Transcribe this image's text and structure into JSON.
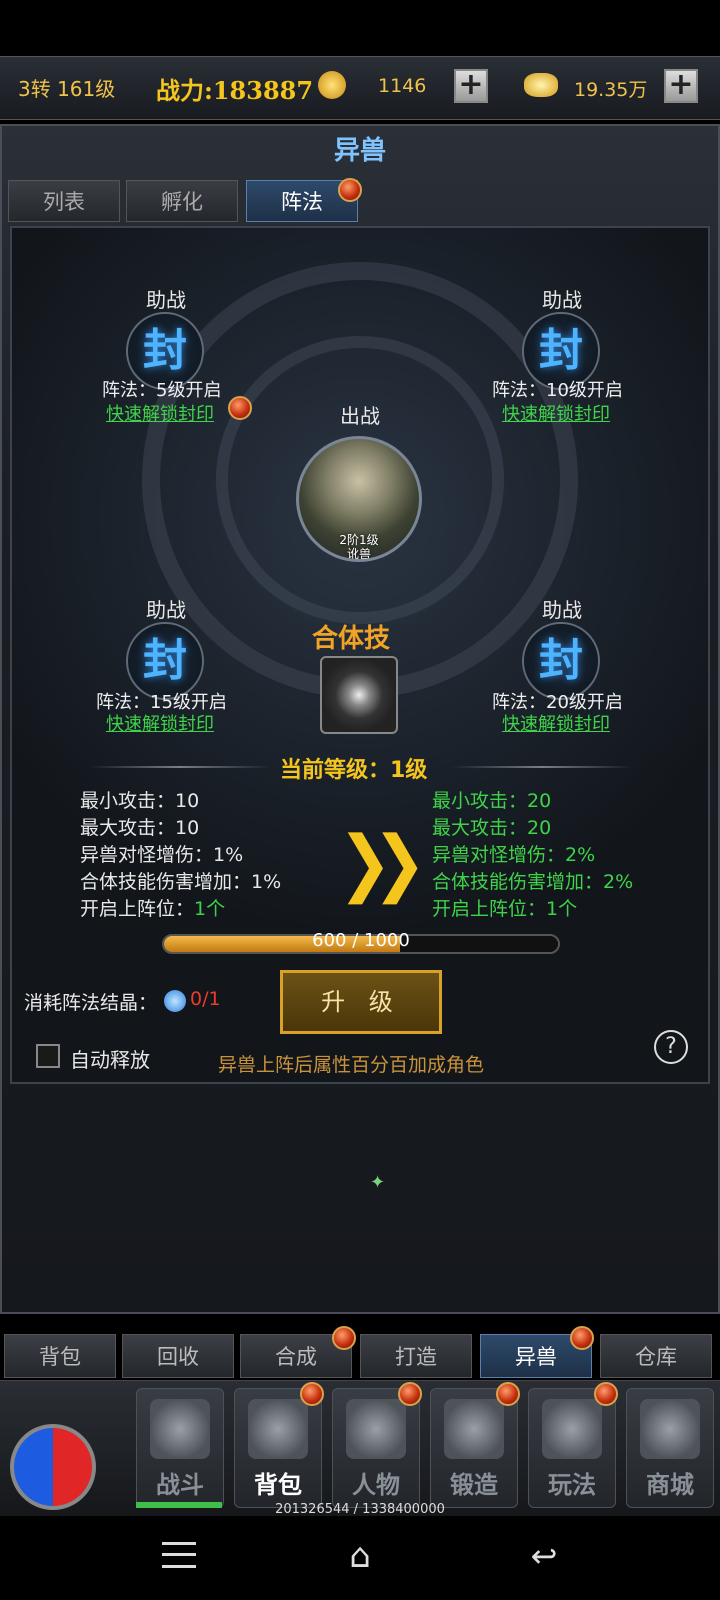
{
  "topbar": {
    "level": "3转 161级",
    "power": "战力:183887",
    "currency1": "1146",
    "currency2": "19.35万"
  },
  "panel": {
    "title": "异兽",
    "tabs": [
      "列表",
      "孵化",
      "阵法"
    ],
    "active_tab": "阵法"
  },
  "formation": {
    "center_label": "出战",
    "main_beast": {
      "level": "2阶1级",
      "name": "讹兽"
    },
    "slots": [
      {
        "label": "助战",
        "seal": "封",
        "info": "阵法：5级开启",
        "unlock": "快速解锁封印"
      },
      {
        "label": "助战",
        "seal": "封",
        "info": "阵法：10级开启",
        "unlock": "快速解锁封印"
      },
      {
        "label": "助战",
        "seal": "封",
        "info": "阵法：15级开启",
        "unlock": "快速解锁封印"
      },
      {
        "label": "助战",
        "seal": "封",
        "info": "阵法：20级开启",
        "unlock": "快速解锁封印"
      }
    ],
    "combo_skill_title": "合体技",
    "current_level": "当前等级：1级"
  },
  "stats": {
    "current": [
      {
        "label": "最小攻击：",
        "value": "10"
      },
      {
        "label": "最大攻击：",
        "value": "10"
      },
      {
        "label": "异兽对怪增伤：",
        "value": "1%"
      },
      {
        "label": "合体技能伤害增加：",
        "value": "1%"
      },
      {
        "label": "开启上阵位：",
        "value": "1个"
      }
    ],
    "next": [
      {
        "label": "最小攻击：",
        "value": "20"
      },
      {
        "label": "最大攻击：",
        "value": "20"
      },
      {
        "label": "异兽对怪增伤：",
        "value": "2%"
      },
      {
        "label": "合体技能伤害增加：",
        "value": "2%"
      },
      {
        "label": "开启上阵位：",
        "value": "1个"
      }
    ]
  },
  "progress": {
    "text": "600 / 1000",
    "fraction": 0.6
  },
  "cost": {
    "label": "消耗阵法结晶：",
    "value": "0/1"
  },
  "upgrade_label": "升 级",
  "auto_release_label": "自动释放",
  "hint": "异兽上阵后属性百分百加成角色",
  "help_label": "?",
  "bottom_tabs": [
    "背包",
    "回收",
    "合成",
    "打造",
    "异兽",
    "仓库"
  ],
  "nav": [
    "战斗",
    "背包",
    "人物",
    "锻造",
    "玩法",
    "商城"
  ],
  "exp_text": "201326544 / 1338400000",
  "colors": {
    "accent_gold": "#f4c51c",
    "green": "#3fd34a",
    "title_blue": "#7fc4ff",
    "seal_blue": "#4fb4ff"
  }
}
